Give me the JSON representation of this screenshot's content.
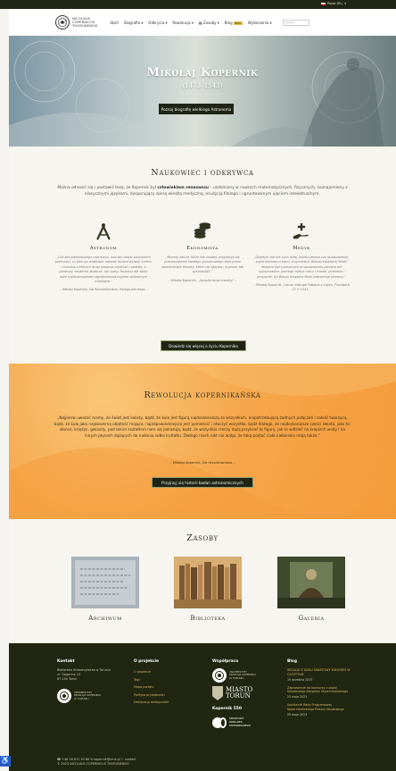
{
  "topbar": {
    "language": "Polski (PL)",
    "caret": "▾"
  },
  "header": {
    "logo_line1": "Nicolaus",
    "logo_line2": "Copernicus",
    "logo_line3": "Thorunensis",
    "nav": [
      {
        "label": "Start"
      },
      {
        "label": "Biografia ▾"
      },
      {
        "label": "Odkrycia ▾"
      },
      {
        "label": "Rewolucja ▾"
      },
      {
        "label": "▦ Zasoby ▾"
      },
      {
        "label": "Blog",
        "badge": "NEW"
      },
      {
        "label": "Wydarzenia ▾"
      }
    ],
    "search_placeholder": "Szukaj…"
  },
  "hero": {
    "title": "Mikołaj Kopernik",
    "years": "(1473–1543)",
    "button": "Poznaj biografię wielkiego Astronoma"
  },
  "scientist": {
    "title": "Naukowiec i odkrywca",
    "intro_before": "Można odnosić się i postawić tezę, że Kopernik był ",
    "intro_bold": "człowiekiem renesansu",
    "intro_after": " – uzdolniony w naukach matematycznych, ﬁzycznych, zaznajomiony z klasycznymi językami, dysponujący sporą wiedzą medyczną, erudycją ﬁlologa i ugruntowanym ujęciem intelektualnym.",
    "columns": [
      {
        "title": "Astronom",
        "icon": "compass-icon",
        "quote": "„Cóż zaś piękniejszego nad niebo, nad ten dobór wszystkich piękności, co jako go właściwie nazwać można wyrazy cielem i mundus z których drugi oznacza czystość i ozdobę, a pierwszy, misterne złożenie, lub szaty. Rozumu dla wielu ludzi najdoskonalszej najpiękniejszą bogiem widzialnym mianowie.”",
        "source": "– Mikołaj Kopernik, De Revolutionibus, Księga pierwsza –"
      },
      {
        "title": "Ekonomista",
        "icon": "coins-icon",
        "quote": "„Monety zaś te, które tak zostały, przyjmuje się postanowienia każdego pomiarowego dnia przez zwierzchnika Monety, które się nazywa i kupione tak sprowadzić.”",
        "source": "– Mikołaj Kopernik, „Sposób bicia monety” –"
      },
      {
        "title": "Medyk",
        "icon": "hand-heart-icon",
        "quote": "„Objętym dla tak sych miłęj dolości Jezuse czo duszpasterzy, sopni dobrzemu panu, a uprzednio Waszej Książęcej Mości mogłem być pomocnym w sprawdzeniu zdrowia nie opuszczałem. Jednego trzeba rzecz i trwale, potrzeba i przyjaciel, bo Wasza Książęca Mość potrzebuje pomocy.”",
        "source": "– Mikołaj Kopernik, List do biskupa Fabiana z Łużyn, Frombork 27 V 1541 –"
      }
    ],
    "button": "Dowiedz się więcej o życiu Kopernika"
  },
  "revolution": {
    "title": "Rewolucja kopernikańska",
    "quote": "„Najpierw uważać mamy, że świat jest kulisty, bądź, że kula jest ﬁgurą najdoskonalszą ze wszystkich, niepotrzebującą żadnych połączeń i całość tworzącą, bądź, że kula jako najobszerną objętość mająca, najodpowiedniejsza jest pomieścić i otoczyć wszystko, bądź dlatego, że najdoskonalsze części świata, jako to: słońce, księżyc, gwiazdy, pod takim kształtem nam się pokazują, bądź, że wszystkie rzeczy dążą przybrać tę ﬁgurę, jak to widzieć na kroplach wody i na innych płynach dążących do nadania sobie kształtu. Dlatego niech nikt nie wątpi, że taką postać ciała niebieskie mają także.”",
    "source": "– Mikołaj Kopernik, De revolutionibus –",
    "button": "Przyjrzyj się historii badań astronomicznych"
  },
  "resources": {
    "title": "Zasoby",
    "items": [
      {
        "label": "Archiwum"
      },
      {
        "label": "Biblioteka"
      },
      {
        "label": "Galeria"
      }
    ]
  },
  "footer": {
    "contact": {
      "title": "Kontakt",
      "lines": [
        "Biblioteka Uniwersytecka w Toruniu",
        "ul. Gagarina 13",
        "87-100 Toruń"
      ],
      "logo_lines": [
        "UNIWERSYTET",
        "MIKOŁAJA KOPERNIKA",
        "W TORUNIU"
      ]
    },
    "about": {
      "title": "O projekcie",
      "links": [
        "O projekcie",
        "Tagi",
        "Mapa portalu",
        "Polityka prywatności",
        "Deklaracja dostępności"
      ]
    },
    "partners": {
      "title": "Współpraca",
      "umk_lines": [
        "UNIWERSYTET",
        "MIKOŁAJA KOPERNIKA",
        "W TORUNIU"
      ],
      "city_line1": "MIASTO",
      "city_line2": "TORUŃ",
      "kopernik_title": "Kopernik 550",
      "kopernik_lines": [
        "ŚWIATOWY",
        "KONGRES",
        "KOPERNIKAŃSKI"
      ]
    },
    "blog": {
      "title": "Blog",
      "posts": [
        {
          "title": "RELACJA Z DOKU ŚWIATOWY KONGRES W OLSZTYNIE",
          "date": "19 września 2023"
        },
        {
          "title": "Zaproszenie na konkursy z okazji Światowego Kongresu Kopernikańskiego",
          "date": "23 maja 2023"
        },
        {
          "title": "Spotkanie Rady Programowej Kopernikańskiego Portalu Naukowego",
          "date": "09 maja 2023"
        }
      ]
    },
    "contact_line": "☎ +48 56 611 43 66   ✉ kopernik@umk.pl   ⚐ contact",
    "copyright": "© 2023 NICOLAUS COPERNICUS THORUNENSIS"
  },
  "accessibility_label": "♿",
  "colors": {
    "dark": "#1f2414",
    "orange": "#f6a64a",
    "gold": "#d7b56a",
    "hero_left": "#7a95a4"
  }
}
